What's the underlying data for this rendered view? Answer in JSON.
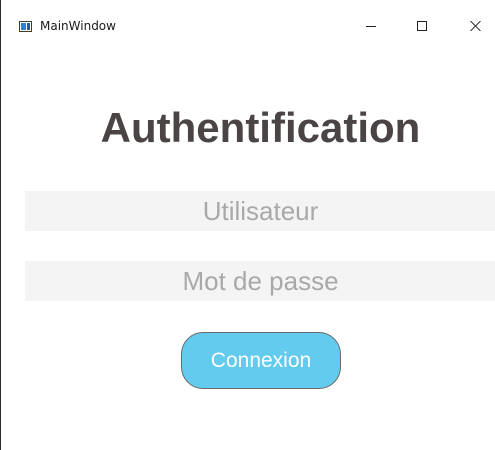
{
  "window": {
    "title": "MainWindow",
    "app_icon": "window-app-icon",
    "controls": {
      "minimize_icon": "minimize-icon",
      "maximize_icon": "maximize-icon",
      "close_icon": "close-icon"
    }
  },
  "login": {
    "heading": "Authentification",
    "username_placeholder": "Utilisateur",
    "password_placeholder": "Mot de passe",
    "submit_label": "Connexion"
  },
  "colors": {
    "heading": "#4a4444",
    "field_background": "#f4f4f4",
    "placeholder": "#a9a9a9",
    "button_background": "#63cbee",
    "button_text": "#ffffff"
  }
}
